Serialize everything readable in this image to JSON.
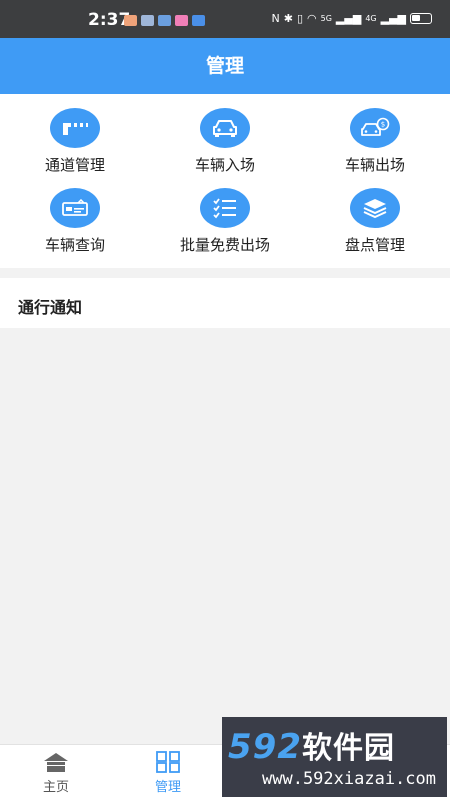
{
  "status_bar": {
    "time": "2:37",
    "notification_colors": [
      "#f0a37a",
      "#9fb6d9",
      "#6b9fe0",
      "#f07fb8",
      "#4a8fe8"
    ],
    "network_label_1": "5G",
    "network_label_2": "4G"
  },
  "header": {
    "title": "管理"
  },
  "menu": {
    "items": [
      {
        "label": "通道管理",
        "icon": "barrier-gate-icon"
      },
      {
        "label": "车辆入场",
        "icon": "car-enter-icon"
      },
      {
        "label": "车辆出场",
        "icon": "car-exit-payment-icon"
      },
      {
        "label": "车辆查询",
        "icon": "license-plate-icon"
      },
      {
        "label": "批量免费出场",
        "icon": "checklist-icon"
      },
      {
        "label": "盘点管理",
        "icon": "stack-layers-icon"
      }
    ]
  },
  "notice": {
    "title": "通行通知"
  },
  "tabbar": {
    "tabs": [
      {
        "label": "主页"
      },
      {
        "label": "管理",
        "active": true
      }
    ]
  },
  "watermark": {
    "brand_num": "592",
    "brand_cn": "软件园",
    "url": "www.592xiazai.com"
  },
  "colors": {
    "primary": "#3f9bf5",
    "status_bar": "#3d3e40",
    "background": "#f2f2f2"
  }
}
